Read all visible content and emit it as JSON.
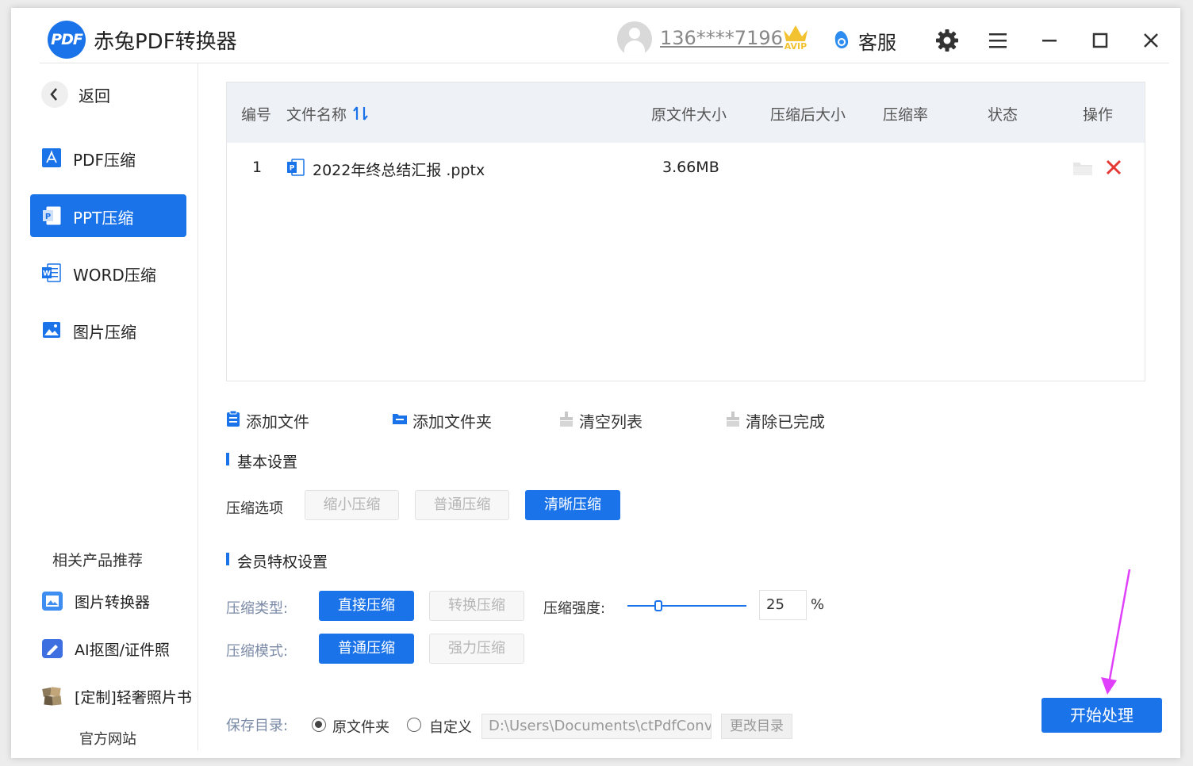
{
  "app": {
    "title": "赤兔PDF转换器",
    "logo_text": "PDF",
    "user_phone": "136****7196",
    "vip_badge": "AVIP",
    "service_label": "客服"
  },
  "sidebar": {
    "back_label": "返回",
    "items": [
      {
        "label": "PDF压缩",
        "icon": "pdf-icon"
      },
      {
        "label": "PPT压缩",
        "icon": "ppt-icon",
        "active": true
      },
      {
        "label": "WORD压缩",
        "icon": "word-icon"
      },
      {
        "label": "图片压缩",
        "icon": "image-icon"
      }
    ],
    "related_title": "相关产品推荐",
    "related": [
      {
        "label": "图片转换器",
        "icon": "image-converter-icon"
      },
      {
        "label": "AI抠图/证件照",
        "icon": "ai-cutout-icon"
      },
      {
        "label": "[定制]轻奢照片书",
        "icon": "photo-book-icon"
      }
    ],
    "official_site": "官方网站"
  },
  "table": {
    "headers": {
      "index": "编号",
      "name": "文件名称",
      "orig_size": "原文件大小",
      "compressed_size": "压缩后大小",
      "ratio": "压缩率",
      "status": "状态",
      "action": "操作"
    },
    "rows": [
      {
        "index": "1",
        "name": "2022年终总结汇报 .pptx",
        "orig_size": "3.66MB",
        "compressed_size": "",
        "ratio": "",
        "status": ""
      }
    ]
  },
  "actions": {
    "add_file": "添加文件",
    "add_folder": "添加文件夹",
    "clear_list": "清空列表",
    "clear_done": "清除已完成"
  },
  "basic": {
    "title": "基本设置",
    "option_label": "压缩选项",
    "options": [
      "缩小压缩",
      "普通压缩",
      "清晰压缩"
    ],
    "selected": "清晰压缩"
  },
  "vip": {
    "title": "会员特权设置",
    "type_label": "压缩类型:",
    "type_options": [
      "直接压缩",
      "转换压缩"
    ],
    "type_selected": "直接压缩",
    "strength_label": "压缩强度:",
    "strength_value": "25",
    "strength_unit": "%",
    "strength_level": 0.25,
    "mode_label": "压缩模式:",
    "mode_options": [
      "普通压缩",
      "强力压缩"
    ],
    "mode_selected": "普通压缩"
  },
  "save": {
    "label": "保存目录:",
    "option_original": "原文件夹",
    "option_custom": "自定义",
    "selected": "原文件夹",
    "path": "D:\\Users\\Documents\\ctPdfConv",
    "change_button": "更改目录"
  },
  "start_button": "开始处理",
  "colors": {
    "accent": "#1a73e8",
    "delete": "#e53935",
    "annotation_arrow": "#e040fb"
  }
}
